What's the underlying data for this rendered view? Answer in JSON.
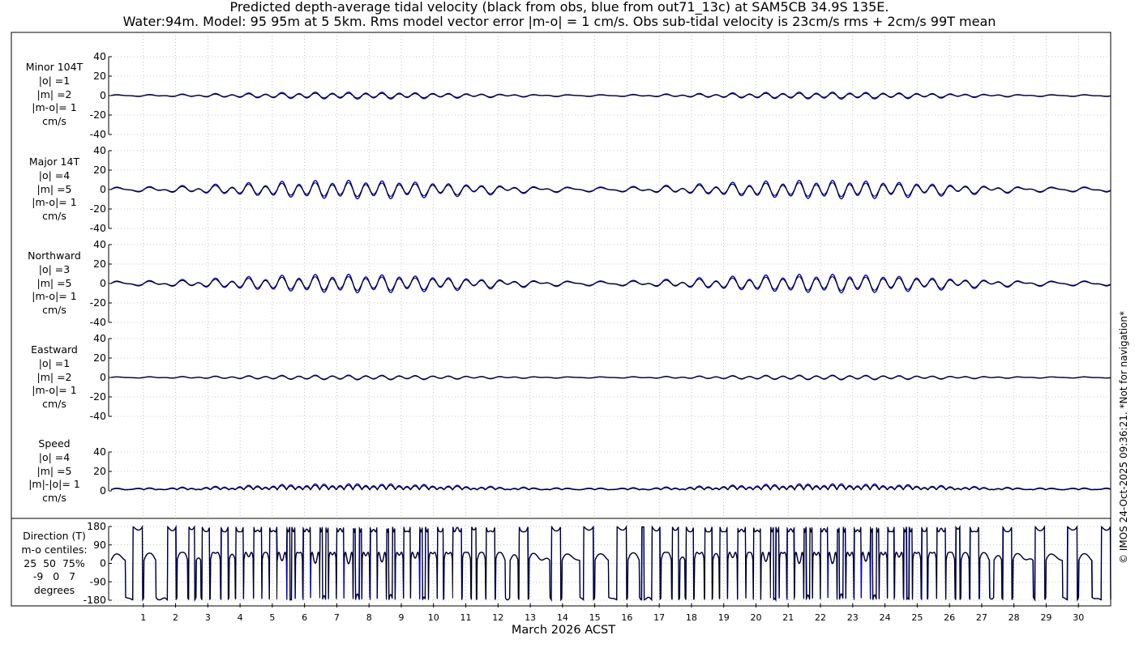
{
  "title_line1": "Predicted depth-average tidal velocity (black from obs, blue from out71_13c) at SAM5CB 34.9S 135E.",
  "title_line2": "Water:94m. Model: 95 95m at 5 5km. Rms model vector error |m-o| = 1 cm/s. Obs sub-tidal velocity is 23cm/s rms + 2cm/s 99T mean",
  "copyright": "© IMOS 24-Oct-2025 09:36:21. *Not for navigation*",
  "xlabel": "March 2026 ACST",
  "colors": {
    "obs": "#000000",
    "model": "#0000cc",
    "grid": "#999999"
  },
  "panels": {
    "minor": {
      "label": "Minor 104T\n|o| =1\n|m| =2\n|m-o|= 1\ncm/s"
    },
    "major": {
      "label": "Major 14T\n|o| =4\n|m| =5\n|m-o|= 1\ncm/s"
    },
    "north": {
      "label": "Northward\n|o| =3\n|m| =5\n|m-o|= 1\ncm/s"
    },
    "east": {
      "label": "Eastward\n|o| =1\n|m| =2\n|m-o|= 1\ncm/s"
    },
    "speed": {
      "label": "Speed\n|o| =4\n|m| =5\n|m|-|o|= 1\ncm/s"
    },
    "direction": {
      "label": "Direction (T)\nm-o centiles:\n25  50  75%\n-9   0   7\ndegrees"
    }
  },
  "chart_data": {
    "type": "line",
    "x_axis": {
      "label": "March 2026 ACST",
      "ticks": [
        "1",
        "2",
        "3",
        "4",
        "5",
        "6",
        "7",
        "8",
        "9",
        "10",
        "11",
        "12",
        "13",
        "14",
        "15",
        "16",
        "17",
        "18",
        "19",
        "20",
        "21",
        "22",
        "23",
        "24",
        "25",
        "26",
        "27",
        "28",
        "29",
        "30"
      ],
      "range_days": [
        0.0,
        31.0
      ]
    },
    "series_names": [
      "obs",
      "model"
    ],
    "subplots": [
      {
        "id": "minor",
        "ylim": [
          -40,
          40
        ],
        "yticks": [
          "40",
          "20",
          "0",
          "-20",
          "-40"
        ],
        "amplitude": {
          "obs": 2,
          "model": 3
        },
        "pattern": "semidiurnal tide with spring-neap modulation"
      },
      {
        "id": "major",
        "ylim": [
          -40,
          40
        ],
        "yticks": [
          "40",
          "20",
          "0",
          "-20",
          "-40"
        ],
        "amplitude": {
          "obs": 6,
          "model": 8
        },
        "pattern": "semidiurnal tide with spring-neap modulation"
      },
      {
        "id": "north",
        "ylim": [
          -40,
          40
        ],
        "yticks": [
          "40",
          "20",
          "0",
          "-20",
          "-40"
        ],
        "amplitude": {
          "obs": 6,
          "model": 8
        },
        "pattern": "semidiurnal tide with spring-neap modulation"
      },
      {
        "id": "east",
        "ylim": [
          -40,
          40
        ],
        "yticks": [
          "40",
          "20",
          "0",
          "-20",
          "-40"
        ],
        "amplitude": {
          "obs": 1.5,
          "model": 2
        },
        "pattern": "semidiurnal tide with spring-neap modulation"
      },
      {
        "id": "speed",
        "ylim": [
          0,
          40
        ],
        "yticks": [
          "40",
          "20",
          "0"
        ],
        "amplitude": {
          "obs": 4,
          "model": 5
        },
        "pattern": "rectified semidiurnal tide"
      },
      {
        "id": "direction",
        "ylim": [
          -180,
          180
        ],
        "yticks": [
          "180",
          "90",
          "0",
          "-90",
          "-180"
        ],
        "pattern": "direction alternating between ~14T and ~194T each half tidal cycle"
      }
    ]
  }
}
